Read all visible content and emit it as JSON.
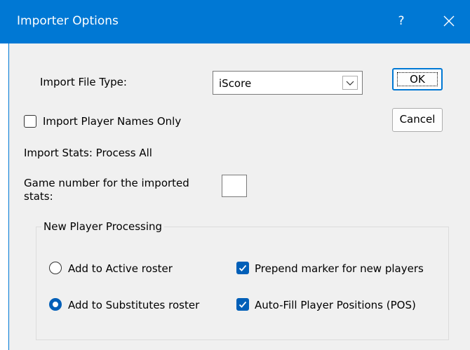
{
  "window": {
    "title": "Importer Options",
    "help_label": "?",
    "close_icon": "close-icon"
  },
  "import_file_type": {
    "label": "Import File Type:",
    "selected": "iScore"
  },
  "buttons": {
    "ok": "OK",
    "cancel": "Cancel"
  },
  "import_names_only": {
    "label": "Import Player Names Only",
    "checked": false
  },
  "import_stats_text": "Import Stats: Process All",
  "game_number": {
    "label_line1": "Game number for the imported",
    "label_line2": "stats:",
    "value": ""
  },
  "new_player_processing": {
    "legend": "New Player Processing",
    "add_active": {
      "label": "Add to Active roster",
      "checked": false
    },
    "add_substitutes": {
      "label": "Add to Substitutes roster",
      "checked": true
    },
    "prepend_marker": {
      "label": "Prepend marker for new players",
      "checked": true
    },
    "autofill_positions": {
      "label": "Auto-Fill Player Positions (POS)",
      "checked": true
    }
  },
  "colors": {
    "title_bar": "#0078d4",
    "accent": "#005fb8",
    "dialog_bg": "#f0f0f0"
  }
}
